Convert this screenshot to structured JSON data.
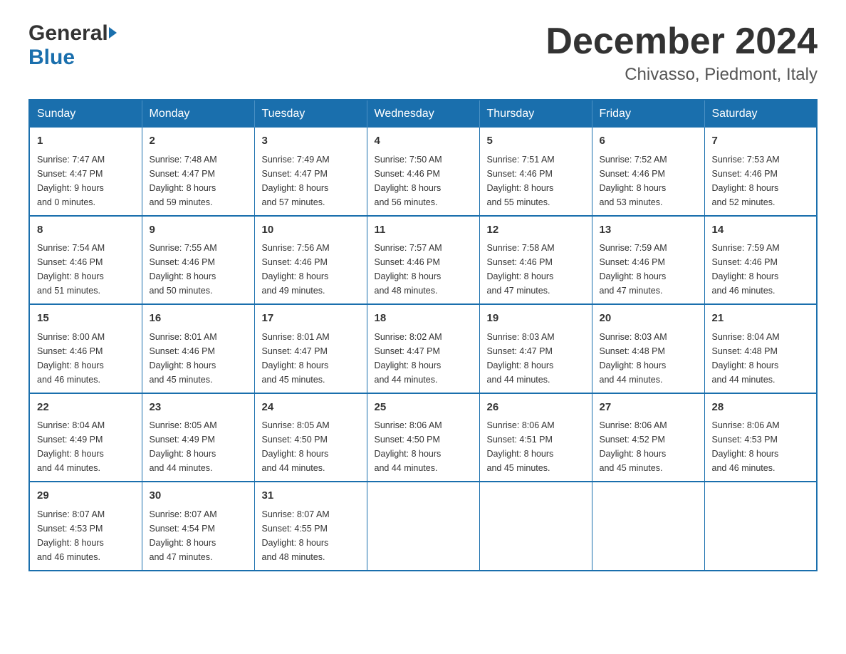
{
  "header": {
    "logo_general": "General",
    "logo_blue": "Blue",
    "month_title": "December 2024",
    "location": "Chivasso, Piedmont, Italy"
  },
  "days_of_week": [
    "Sunday",
    "Monday",
    "Tuesday",
    "Wednesday",
    "Thursday",
    "Friday",
    "Saturday"
  ],
  "weeks": [
    [
      {
        "day": "1",
        "sunrise": "7:47 AM",
        "sunset": "4:47 PM",
        "daylight": "9 hours and 0 minutes."
      },
      {
        "day": "2",
        "sunrise": "7:48 AM",
        "sunset": "4:47 PM",
        "daylight": "8 hours and 59 minutes."
      },
      {
        "day": "3",
        "sunrise": "7:49 AM",
        "sunset": "4:47 PM",
        "daylight": "8 hours and 57 minutes."
      },
      {
        "day": "4",
        "sunrise": "7:50 AM",
        "sunset": "4:46 PM",
        "daylight": "8 hours and 56 minutes."
      },
      {
        "day": "5",
        "sunrise": "7:51 AM",
        "sunset": "4:46 PM",
        "daylight": "8 hours and 55 minutes."
      },
      {
        "day": "6",
        "sunrise": "7:52 AM",
        "sunset": "4:46 PM",
        "daylight": "8 hours and 53 minutes."
      },
      {
        "day": "7",
        "sunrise": "7:53 AM",
        "sunset": "4:46 PM",
        "daylight": "8 hours and 52 minutes."
      }
    ],
    [
      {
        "day": "8",
        "sunrise": "7:54 AM",
        "sunset": "4:46 PM",
        "daylight": "8 hours and 51 minutes."
      },
      {
        "day": "9",
        "sunrise": "7:55 AM",
        "sunset": "4:46 PM",
        "daylight": "8 hours and 50 minutes."
      },
      {
        "day": "10",
        "sunrise": "7:56 AM",
        "sunset": "4:46 PM",
        "daylight": "8 hours and 49 minutes."
      },
      {
        "day": "11",
        "sunrise": "7:57 AM",
        "sunset": "4:46 PM",
        "daylight": "8 hours and 48 minutes."
      },
      {
        "day": "12",
        "sunrise": "7:58 AM",
        "sunset": "4:46 PM",
        "daylight": "8 hours and 47 minutes."
      },
      {
        "day": "13",
        "sunrise": "7:59 AM",
        "sunset": "4:46 PM",
        "daylight": "8 hours and 47 minutes."
      },
      {
        "day": "14",
        "sunrise": "7:59 AM",
        "sunset": "4:46 PM",
        "daylight": "8 hours and 46 minutes."
      }
    ],
    [
      {
        "day": "15",
        "sunrise": "8:00 AM",
        "sunset": "4:46 PM",
        "daylight": "8 hours and 46 minutes."
      },
      {
        "day": "16",
        "sunrise": "8:01 AM",
        "sunset": "4:46 PM",
        "daylight": "8 hours and 45 minutes."
      },
      {
        "day": "17",
        "sunrise": "8:01 AM",
        "sunset": "4:47 PM",
        "daylight": "8 hours and 45 minutes."
      },
      {
        "day": "18",
        "sunrise": "8:02 AM",
        "sunset": "4:47 PM",
        "daylight": "8 hours and 44 minutes."
      },
      {
        "day": "19",
        "sunrise": "8:03 AM",
        "sunset": "4:47 PM",
        "daylight": "8 hours and 44 minutes."
      },
      {
        "day": "20",
        "sunrise": "8:03 AM",
        "sunset": "4:48 PM",
        "daylight": "8 hours and 44 minutes."
      },
      {
        "day": "21",
        "sunrise": "8:04 AM",
        "sunset": "4:48 PM",
        "daylight": "8 hours and 44 minutes."
      }
    ],
    [
      {
        "day": "22",
        "sunrise": "8:04 AM",
        "sunset": "4:49 PM",
        "daylight": "8 hours and 44 minutes."
      },
      {
        "day": "23",
        "sunrise": "8:05 AM",
        "sunset": "4:49 PM",
        "daylight": "8 hours and 44 minutes."
      },
      {
        "day": "24",
        "sunrise": "8:05 AM",
        "sunset": "4:50 PM",
        "daylight": "8 hours and 44 minutes."
      },
      {
        "day": "25",
        "sunrise": "8:06 AM",
        "sunset": "4:50 PM",
        "daylight": "8 hours and 44 minutes."
      },
      {
        "day": "26",
        "sunrise": "8:06 AM",
        "sunset": "4:51 PM",
        "daylight": "8 hours and 45 minutes."
      },
      {
        "day": "27",
        "sunrise": "8:06 AM",
        "sunset": "4:52 PM",
        "daylight": "8 hours and 45 minutes."
      },
      {
        "day": "28",
        "sunrise": "8:06 AM",
        "sunset": "4:53 PM",
        "daylight": "8 hours and 46 minutes."
      }
    ],
    [
      {
        "day": "29",
        "sunrise": "8:07 AM",
        "sunset": "4:53 PM",
        "daylight": "8 hours and 46 minutes."
      },
      {
        "day": "30",
        "sunrise": "8:07 AM",
        "sunset": "4:54 PM",
        "daylight": "8 hours and 47 minutes."
      },
      {
        "day": "31",
        "sunrise": "8:07 AM",
        "sunset": "4:55 PM",
        "daylight": "8 hours and 48 minutes."
      },
      null,
      null,
      null,
      null
    ]
  ],
  "labels": {
    "sunrise_prefix": "Sunrise: ",
    "sunset_prefix": "Sunset: ",
    "daylight_prefix": "Daylight: "
  }
}
